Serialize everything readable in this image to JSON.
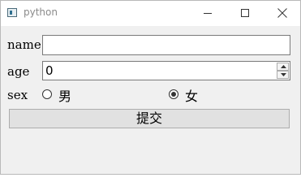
{
  "window": {
    "title": "python"
  },
  "form": {
    "name_label": "name",
    "name_value": "",
    "age_label": "age",
    "age_value": "0",
    "sex_label": "sex",
    "sex_options": [
      {
        "label": "男",
        "selected": false
      },
      {
        "label": "女",
        "selected": true
      }
    ],
    "submit_label": "提交"
  },
  "icons": {
    "app": "python-app-icon",
    "minimize": "minimize-icon",
    "maximize": "maximize-icon",
    "close": "close-icon",
    "spin_up": "chevron-up-icon",
    "spin_down": "chevron-down-icon"
  }
}
